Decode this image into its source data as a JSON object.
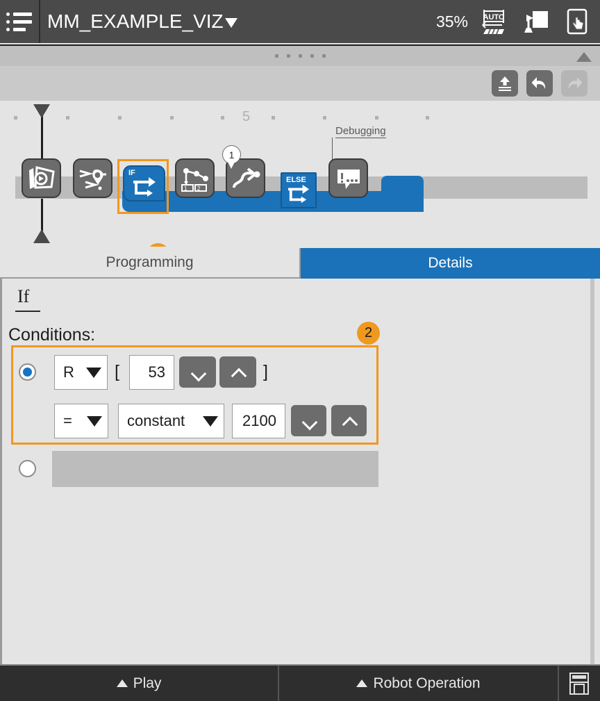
{
  "topbar": {
    "menu_icon": "list-menu-icon",
    "program_name": "MM_EXAMPLE_VIZ",
    "dropdown_icon": "caret-down-icon",
    "speed": "35%",
    "mode_icon": "auto-mode-icon",
    "teach_icon": "teach-pendant-icon",
    "touch_icon": "touch-screen-icon"
  },
  "dragbar": {
    "handle_icon": "drag-dots-icon",
    "collapse_icon": "caret-up-icon"
  },
  "edit_toolbar": {
    "upload_icon": "upload-icon",
    "undo_icon": "undo-icon",
    "redo_icon": "redo-icon"
  },
  "flow": {
    "ruler_label": "5",
    "selected_badge": "1",
    "branch_badge": "1",
    "debug_label": "Debugging",
    "nodes": [
      {
        "name": "vision-program-node",
        "icon": "vision-play-icon",
        "type": "grey",
        "tag": ""
      },
      {
        "name": "move-waypoint-node",
        "icon": "path-waypoint-icon",
        "type": "grey",
        "tag": ""
      },
      {
        "name": "if-node",
        "icon": "branch-arrow-icon",
        "type": "blue",
        "tag": "IF"
      },
      {
        "name": "sequence-node",
        "icon": "graph-sequence-icon",
        "type": "grey",
        "tag": ""
      },
      {
        "name": "move-curve-node",
        "icon": "curve-move-icon",
        "type": "grey",
        "tag": ""
      },
      {
        "name": "else-node",
        "icon": "branch-arrow-icon",
        "type": "blue",
        "tag": "ELSE"
      },
      {
        "name": "message-node",
        "icon": "speech-bubble-icon",
        "type": "grey",
        "tag": ""
      }
    ]
  },
  "tabs": [
    {
      "label": "Programming",
      "active": false
    },
    {
      "label": "Details",
      "active": true
    }
  ],
  "details": {
    "heading": "If",
    "conditions_label": "Conditions:",
    "callout_badge": "2",
    "condition_rows": [
      {
        "selected": true,
        "register_type": "R",
        "bracket_open": "[",
        "index": "53",
        "bracket_close": "]",
        "operator": "=",
        "operand_type": "constant",
        "operand_value": "2100",
        "down_icon": "chevron-down-icon",
        "up_icon": "chevron-up-icon"
      },
      {
        "selected": false,
        "empty": true
      }
    ]
  },
  "bottombar": {
    "play_label": "Play",
    "play_caret_icon": "caret-up-icon",
    "robot_label": "Robot Operation",
    "robot_caret_icon": "caret-up-icon",
    "save_icon": "save-floppy-icon"
  }
}
